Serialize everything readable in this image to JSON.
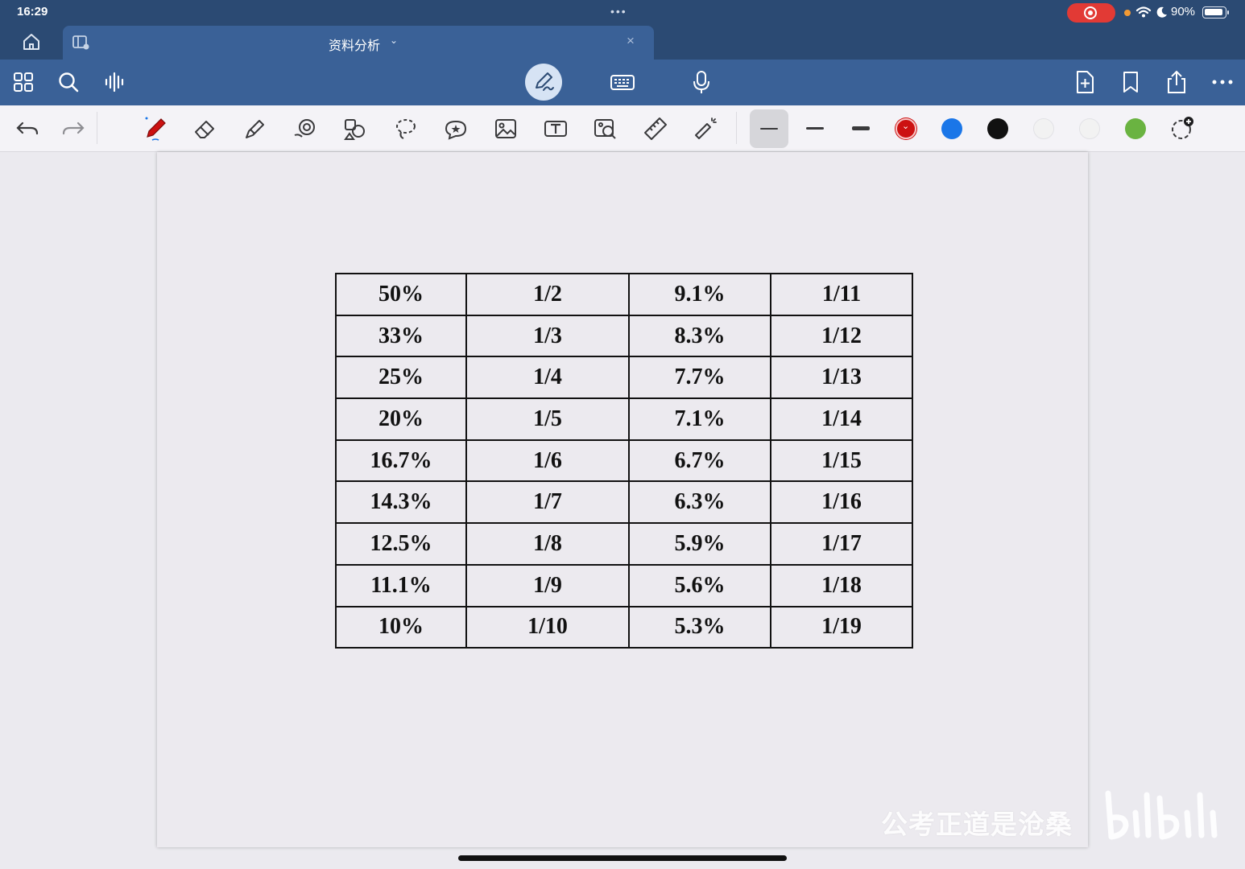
{
  "status_bar": {
    "time": "16:29",
    "dots": "•••",
    "battery": "90%",
    "battery_level": 0.9,
    "recording_color": "#e23a35"
  },
  "tab": {
    "title": "资料分析",
    "close": "×"
  },
  "main_toolbar": {
    "left_icons": [
      "grid-icon",
      "search-icon",
      "audio-wave-icon"
    ],
    "center_icons": [
      "pen-mode-icon",
      "keyboard-icon",
      "microphone-icon"
    ],
    "right_icons": [
      "add-page-icon",
      "bookmark-icon",
      "share-icon",
      "more-icon"
    ]
  },
  "tools": {
    "names": [
      "undo-icon",
      "redo-icon",
      "pen-icon",
      "eraser-icon",
      "highlighter-icon",
      "shape-icon",
      "element-icon",
      "lasso-icon",
      "sticker-icon",
      "image-icon",
      "text-icon",
      "camera-scan-icon",
      "ruler-icon",
      "laser-pointer-icon"
    ],
    "colors": [
      "#cc1111",
      "#1a76e8",
      "#111111",
      "#f2f2f2",
      "#f2f2f2",
      "#6ab341"
    ],
    "selected_color": "#cc1111"
  },
  "table": {
    "rows": [
      [
        "50%",
        "1/2",
        "9.1%",
        "1/11"
      ],
      [
        "33%",
        "1/3",
        "8.3%",
        "1/12"
      ],
      [
        "25%",
        "1/4",
        "7.7%",
        "1/13"
      ],
      [
        "20%",
        "1/5",
        "7.1%",
        "1/14"
      ],
      [
        "16.7%",
        "1/6",
        "6.7%",
        "1/15"
      ],
      [
        "14.3%",
        "1/7",
        "6.3%",
        "1/16"
      ],
      [
        "12.5%",
        "1/8",
        "5.9%",
        "1/17"
      ],
      [
        "11.1%",
        "1/9",
        "5.6%",
        "1/18"
      ],
      [
        "10%",
        "1/10",
        "5.3%",
        "1/19"
      ]
    ]
  },
  "watermark": {
    "text": "公考正道是沧桑",
    "logo": "bilibili"
  }
}
